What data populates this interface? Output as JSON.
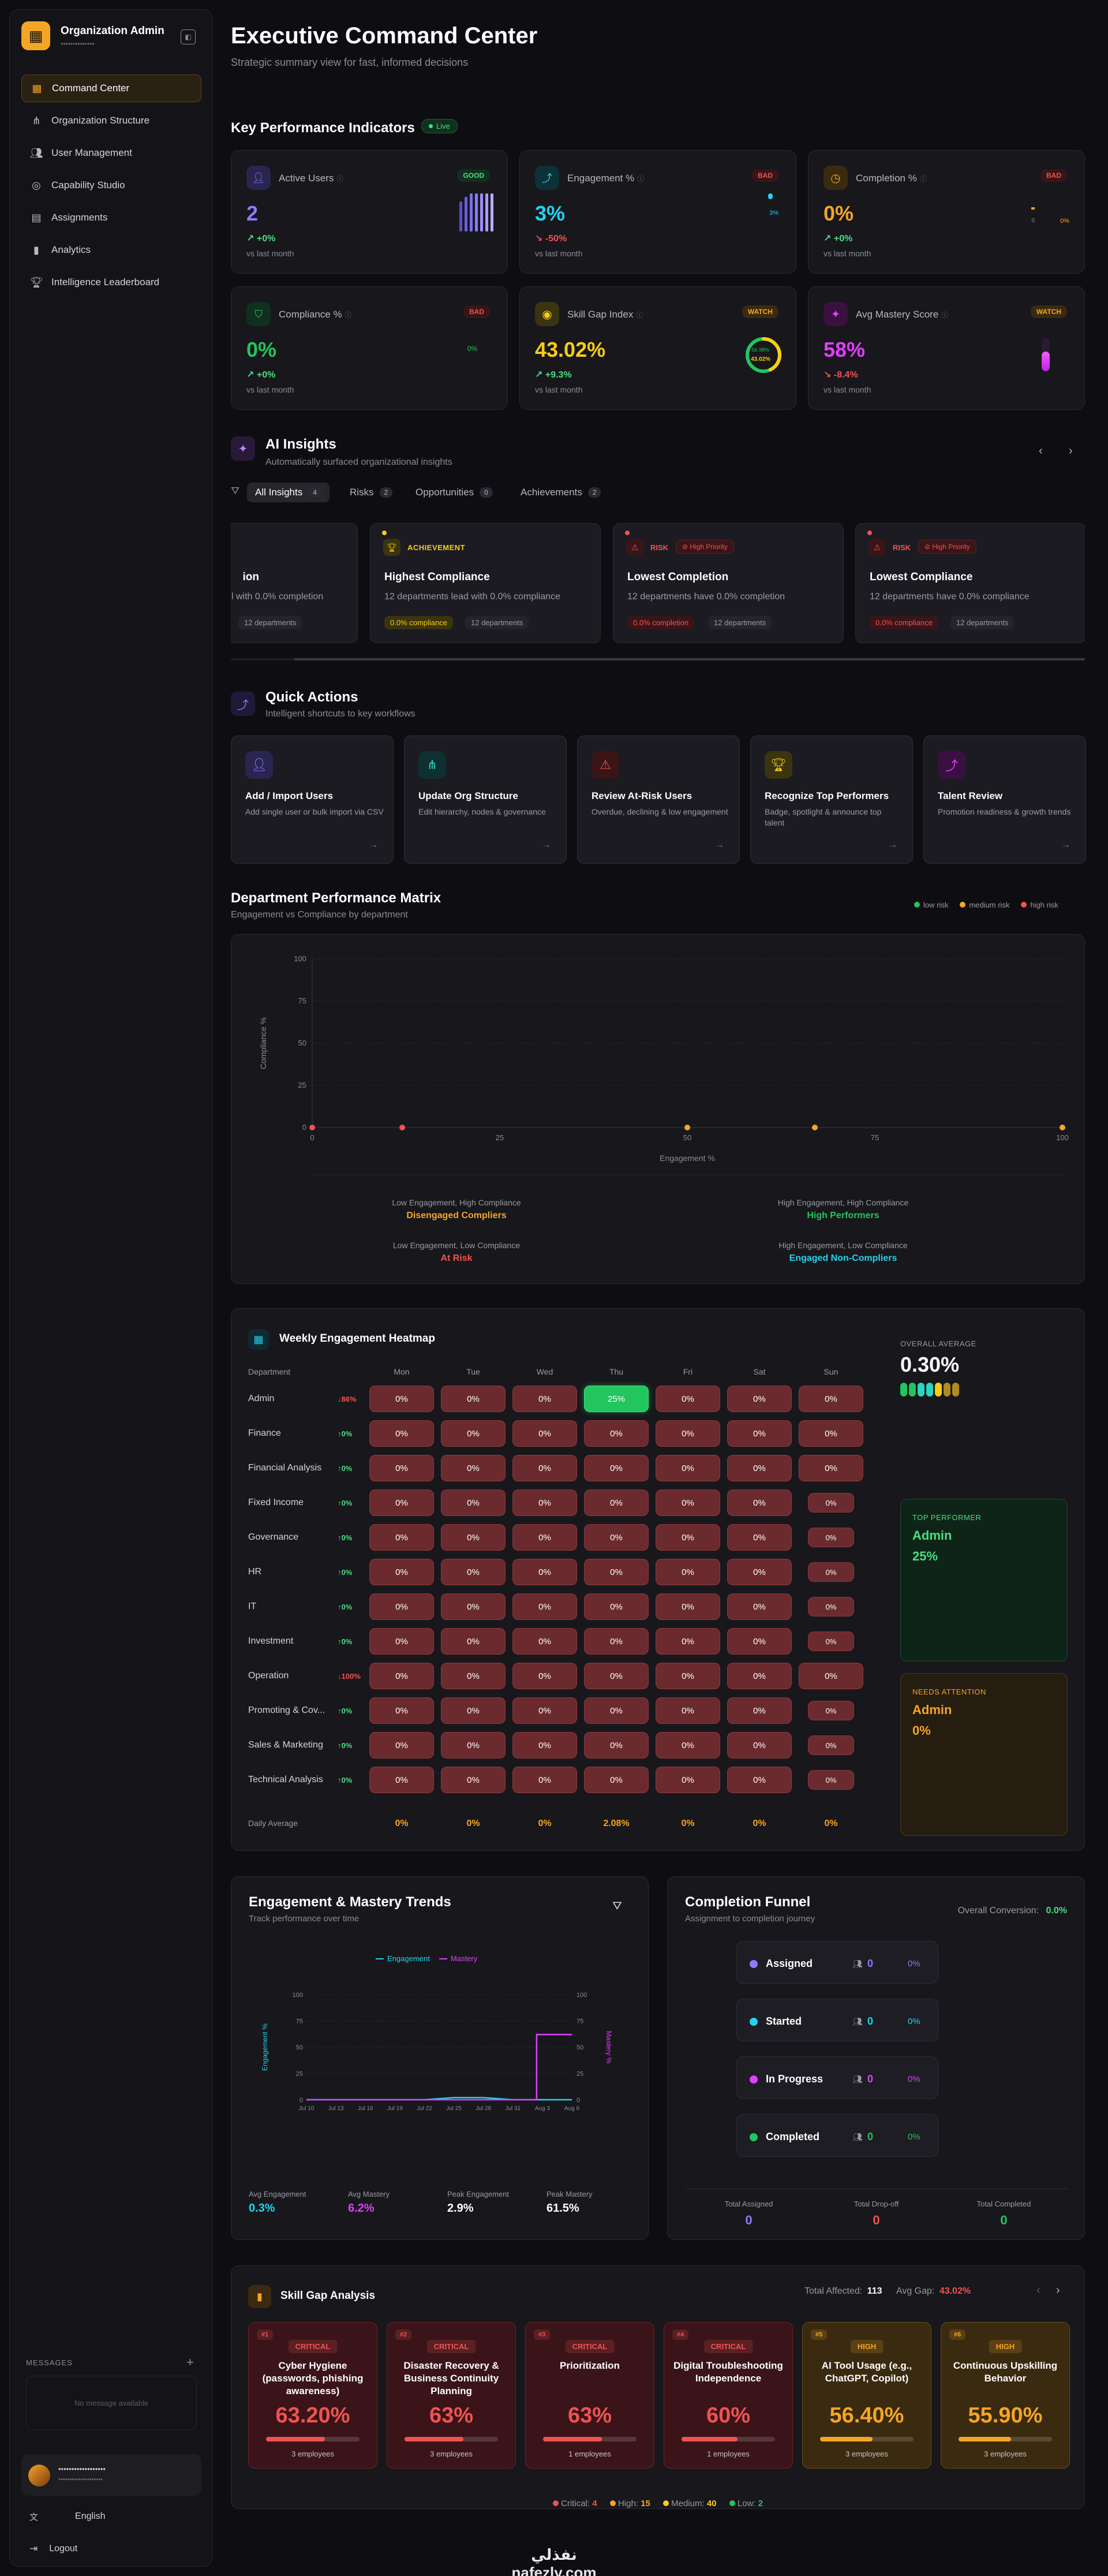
{
  "sidebar": {
    "org_title": "Organization Admin",
    "org_subtitle": "••••••••••••••",
    "items": [
      {
        "label": "Command Center",
        "icon": "grid-icon"
      },
      {
        "label": "Organization Structure",
        "icon": "org-chart-icon"
      },
      {
        "label": "User Management",
        "icon": "users-icon"
      },
      {
        "label": "Capability Studio",
        "icon": "compass-icon"
      },
      {
        "label": "Assignments",
        "icon": "book-icon"
      },
      {
        "label": "Analytics",
        "icon": "bar-chart-icon"
      },
      {
        "label": "Intelligence Leaderboard",
        "icon": "trophy-icon"
      }
    ],
    "messages_label": "MESSAGES",
    "no_message": "No message available",
    "user_name": "••••••••••••••••••",
    "user_email": "••••••••••••••••••••",
    "language": "English",
    "logout": "Logout"
  },
  "header": {
    "title": "Executive Command Center",
    "subtitle": "Strategic summary view for fast, informed decisions"
  },
  "kpi": {
    "title": "Key Performance Indicators",
    "live": "Live",
    "cards": [
      {
        "label": "Active Users",
        "badge": "GOOD",
        "value": "2",
        "change": "+0%",
        "vs": "vs last month",
        "color": "#8b7bff"
      },
      {
        "label": "Engagement %",
        "badge": "BAD",
        "value": "3%",
        "change": "-50%",
        "vs": "vs last month",
        "color": "#22d3ee",
        "mini": "3%"
      },
      {
        "label": "Completion %",
        "badge": "BAD",
        "value": "0%",
        "change": "+0%",
        "vs": "vs last month",
        "color": "#f5a524",
        "mini_a": "0",
        "mini_b": "0%"
      },
      {
        "label": "Compliance %",
        "badge": "BAD",
        "value": "0%",
        "change": "+0%",
        "vs": "vs last month",
        "color": "#22c55e",
        "mini": "0%"
      },
      {
        "label": "Skill Gap Index",
        "badge": "WATCH",
        "value": "43.02%",
        "change": "+9.3%",
        "vs": "vs last month",
        "color": "#facc15",
        "ring_top": "56.98%",
        "ring_bottom": "43.02%",
        "ring_value": 43.02
      },
      {
        "label": "Avg Mastery Score",
        "badge": "WATCH",
        "value": "58%",
        "change": "-8.4%",
        "vs": "vs last month",
        "color": "#e040fb",
        "tube_fill": 58
      }
    ]
  },
  "insights": {
    "title": "AI Insights",
    "subtitle": "Automatically surfaced organizational insights",
    "tabs": [
      {
        "label": "All Insights",
        "count": "4"
      },
      {
        "label": "Risks",
        "count": "2"
      },
      {
        "label": "Opportunities",
        "count": "0"
      },
      {
        "label": "Achievements",
        "count": "2"
      }
    ],
    "cards": [
      {
        "title": "ion",
        "desc": "l with 0.0% completion",
        "tag": "",
        "tag2": "12 departments"
      },
      {
        "kind": "ACHIEVEMENT",
        "title": "Highest Compliance",
        "desc": "12 departments lead with 0.0% compliance",
        "tag": "0.0% compliance",
        "tag2": "12 departments"
      },
      {
        "kind": "RISK",
        "priority": "High Priority",
        "title": "Lowest Completion",
        "desc": "12 departments have 0.0% completion",
        "tag": "0.0% completion",
        "tag2": "12 departments"
      },
      {
        "kind": "RISK",
        "priority": "High Priority",
        "title": "Lowest Compliance",
        "desc": "12 departments have 0.0% compliance",
        "tag": "0.0% compliance",
        "tag2": "12 departments"
      }
    ]
  },
  "quick_actions": {
    "title": "Quick Actions",
    "subtitle": "Intelligent shortcuts to key workflows",
    "items": [
      {
        "title": "Add / Import Users",
        "desc": "Add single user or bulk import via CSV",
        "color": "#8b7bff"
      },
      {
        "title": "Update Org Structure",
        "desc": "Edit hierarchy, nodes & governance",
        "color": "#2dd4bf"
      },
      {
        "title": "Review At-Risk Users",
        "desc": "Overdue, declining & low engagement",
        "color": "#f05252"
      },
      {
        "title": "Recognize Top Performers",
        "desc": "Badge, spotlight & announce top talent",
        "color": "#facc15"
      },
      {
        "title": "Talent Review",
        "desc": "Promotion readiness & growth trends",
        "color": "#e040fb"
      }
    ]
  },
  "matrix": {
    "title": "Department Performance Matrix",
    "subtitle": "Engagement vs Compliance by department",
    "legend": [
      "low risk",
      "medium risk",
      "high risk"
    ],
    "y_ticks": [
      "100",
      "75",
      "50",
      "25",
      "0"
    ],
    "x_ticks": [
      "0",
      "25",
      "50",
      "75",
      "100"
    ],
    "ylabel": "Compliance %",
    "xlabel": "Engagement %",
    "quadrants": [
      {
        "top": "Low Engagement, High Compliance",
        "name": "Disengaged Compliers",
        "color": "#f5a524"
      },
      {
        "top": "High Engagement, High Compliance",
        "name": "High Performers",
        "color": "#22c55e"
      },
      {
        "top": "Low Engagement, Low Compliance",
        "name": "At Risk",
        "color": "#f05252"
      },
      {
        "top": "High Engagement, Low Compliance",
        "name": "Engaged Non-Compliers",
        "color": "#22d3ee"
      }
    ]
  },
  "chart_data": [
    {
      "type": "scatter",
      "title": "Department Performance Matrix",
      "xlabel": "Engagement %",
      "ylabel": "Compliance %",
      "xlim": [
        0,
        100
      ],
      "ylim": [
        0,
        100
      ],
      "points": [
        {
          "x": 0,
          "y": 0,
          "risk": "high"
        },
        {
          "x": 12,
          "y": 0,
          "risk": "high"
        },
        {
          "x": 50,
          "y": 0,
          "risk": "medium"
        },
        {
          "x": 67,
          "y": 0,
          "risk": "medium"
        },
        {
          "x": 100,
          "y": 0,
          "risk": "medium"
        }
      ]
    },
    {
      "type": "line",
      "title": "Engagement & Mastery Trends",
      "categories": [
        "Jul 10",
        "Jul 13",
        "Jul 16",
        "Jul 19",
        "Jul 22",
        "Jul 25",
        "Jul 28",
        "Jul 31",
        "Aug 3",
        "Aug 6"
      ],
      "series": [
        {
          "name": "Engagement",
          "values": [
            0,
            0,
            0,
            0,
            0,
            2,
            2,
            0,
            0,
            0
          ]
        },
        {
          "name": "Mastery",
          "values": [
            0,
            0,
            0,
            0,
            0,
            0,
            0,
            0,
            62,
            62
          ]
        }
      ],
      "ylim": [
        0,
        100
      ]
    }
  ],
  "heatmap": {
    "title": "Weekly Engagement Heatmap",
    "dept_header": "Department",
    "days": [
      "Mon",
      "Tue",
      "Wed",
      "Thu",
      "Fri",
      "Sat",
      "Sun"
    ],
    "rows": [
      {
        "name": "Admin",
        "chg": "↓86%",
        "vals": [
          "0%",
          "0%",
          "0%",
          "25%",
          "0%",
          "0%",
          "0%"
        ]
      },
      {
        "name": "Finance",
        "chg": "↑0%",
        "vals": [
          "0%",
          "0%",
          "0%",
          "0%",
          "0%",
          "0%",
          "0%"
        ]
      },
      {
        "name": "Financial Analysis",
        "chg": "↑0%",
        "vals": [
          "0%",
          "0%",
          "0%",
          "0%",
          "0%",
          "0%",
          "0%"
        ]
      },
      {
        "name": "Fixed Income",
        "chg": "↑0%",
        "vals": [
          "0%",
          "0%",
          "0%",
          "0%",
          "0%",
          "0%",
          "0%"
        ]
      },
      {
        "name": "Governance",
        "chg": "↑0%",
        "vals": [
          "0%",
          "0%",
          "0%",
          "0%",
          "0%",
          "0%",
          "0%"
        ]
      },
      {
        "name": "HR",
        "chg": "↑0%",
        "vals": [
          "0%",
          "0%",
          "0%",
          "0%",
          "0%",
          "0%",
          "0%"
        ]
      },
      {
        "name": "IT",
        "chg": "↑0%",
        "vals": [
          "0%",
          "0%",
          "0%",
          "0%",
          "0%",
          "0%",
          "0%"
        ]
      },
      {
        "name": "Investment",
        "chg": "↑0%",
        "vals": [
          "0%",
          "0%",
          "0%",
          "0%",
          "0%",
          "0%",
          "0%"
        ]
      },
      {
        "name": "Operation",
        "chg": "↓100%",
        "vals": [
          "0%",
          "0%",
          "0%",
          "0%",
          "0%",
          "0%",
          "0%"
        ]
      },
      {
        "name": "Promoting & Cov...",
        "chg": "↑0%",
        "vals": [
          "0%",
          "0%",
          "0%",
          "0%",
          "0%",
          "0%",
          "0%"
        ]
      },
      {
        "name": "Sales & Marketing",
        "chg": "↑0%",
        "vals": [
          "0%",
          "0%",
          "0%",
          "0%",
          "0%",
          "0%",
          "0%"
        ]
      },
      {
        "name": "Technical Analysis",
        "chg": "↑0%",
        "vals": [
          "0%",
          "0%",
          "0%",
          "0%",
          "0%",
          "0%",
          "0%"
        ]
      }
    ],
    "daily_label": "Daily Average",
    "daily": [
      "0%",
      "0%",
      "0%",
      "2.08%",
      "0%",
      "0%",
      "0%"
    ],
    "overall_label": "OVERALL AVERAGE",
    "overall_value": "0.30%",
    "top_label": "TOP PERFORMER",
    "top_name": "Admin",
    "top_value": "25%",
    "attn_label": "NEEDS ATTENTION",
    "attn_name": "Admin",
    "attn_value": "0%"
  },
  "trends": {
    "title": "Engagement & Mastery Trends",
    "subtitle": "Track performance over time",
    "legend": [
      "Engagement",
      "Mastery"
    ],
    "ylabel_left": "Engagement %",
    "ylabel_right": "Mastery %",
    "y_ticks": [
      "100",
      "75",
      "50",
      "25",
      "0"
    ],
    "stats": [
      {
        "label": "Avg Engagement",
        "value": "0.3%",
        "color": "#22d3ee"
      },
      {
        "label": "Avg Mastery",
        "value": "6.2%",
        "color": "#e040fb"
      },
      {
        "label": "Peak Engagement",
        "value": "2.9%",
        "color": "#ffffff"
      },
      {
        "label": "Peak Mastery",
        "value": "61.5%",
        "color": "#ffffff"
      }
    ]
  },
  "funnel": {
    "title": "Completion Funnel",
    "subtitle": "Assignment to completion journey",
    "conversion_label": "Overall Conversion:",
    "conversion_value": "0.0%",
    "stages": [
      {
        "label": "Assigned",
        "count": "0",
        "pct": "0%",
        "color": "#8b7bff"
      },
      {
        "label": "Started",
        "count": "0",
        "pct": "0%",
        "color": "#22d3ee"
      },
      {
        "label": "In Progress",
        "count": "0",
        "pct": "0%",
        "color": "#e040fb"
      },
      {
        "label": "Completed",
        "count": "0",
        "pct": "0%",
        "color": "#22c55e"
      }
    ],
    "totals": [
      {
        "label": "Total Assigned",
        "value": "0",
        "color": "#8b7bff"
      },
      {
        "label": "Total Drop-off",
        "value": "0",
        "color": "#f05252"
      },
      {
        "label": "Total Completed",
        "value": "0",
        "color": "#22c55e"
      }
    ]
  },
  "skill_gap": {
    "title": "Skill Gap Analysis",
    "affected_label": "Total Affected:",
    "affected_value": "113",
    "avg_label": "Avg Gap:",
    "avg_value": "43.02%",
    "cards": [
      {
        "n": "#1",
        "level": "CRITICAL",
        "name": "Cyber Hygiene (passwords, phishing awareness)",
        "pct": "63.20%",
        "fill": 63.2,
        "emp": "3 employees"
      },
      {
        "n": "#2",
        "level": "CRITICAL",
        "name": "Disaster Recovery & Business Continuity Planning",
        "pct": "63%",
        "fill": 63,
        "emp": "3 employees"
      },
      {
        "n": "#3",
        "level": "CRITICAL",
        "name": "Prioritization",
        "pct": "63%",
        "fill": 63,
        "emp": "1 employees"
      },
      {
        "n": "#4",
        "level": "CRITICAL",
        "name": "Digital Troubleshooting Independence",
        "pct": "60%",
        "fill": 60,
        "emp": "1 employees"
      },
      {
        "n": "#5",
        "level": "HIGH",
        "name": "AI Tool Usage (e.g., ChatGPT, Copilot)",
        "pct": "56.40%",
        "fill": 56.4,
        "emp": "3 employees"
      },
      {
        "n": "#6",
        "level": "HIGH",
        "name": "Continuous Upskilling Behavior",
        "pct": "55.90%",
        "fill": 55.9,
        "emp": "3 employees"
      }
    ],
    "summary": [
      {
        "label": "Critical:",
        "value": "4",
        "color": "#f05252"
      },
      {
        "label": "High:",
        "value": "15",
        "color": "#f5a524"
      },
      {
        "label": "Medium:",
        "value": "40",
        "color": "#facc15"
      },
      {
        "label": "Low:",
        "value": "2",
        "color": "#22c55e"
      }
    ]
  },
  "watermark": "نفذلي nafezly.com"
}
